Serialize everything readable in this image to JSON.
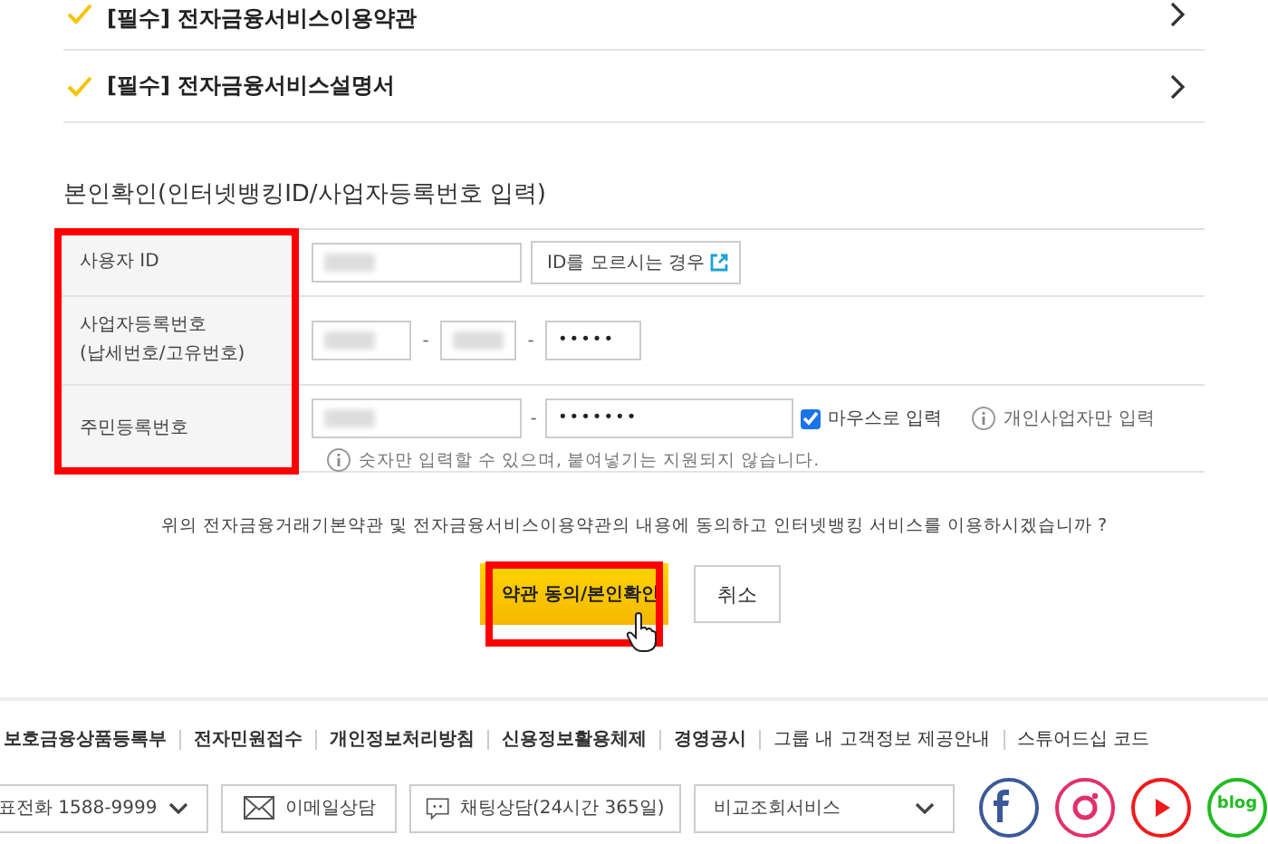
{
  "terms": [
    {
      "label": "[필수] 전자금융서비스이용약관",
      "checked": true
    },
    {
      "label": "[필수] 전자금융서비스설명서",
      "checked": true
    }
  ],
  "section_title": "본인확인(인터넷뱅킹ID/사업자등록번호 입력)",
  "form": {
    "rows": [
      {
        "kind": "id",
        "label": "사용자 ID",
        "button": "ID를 모르시는 경우"
      },
      {
        "kind": "business",
        "label": "사업자등록번호\n(납세번호/고유번호)",
        "separator": "-",
        "masked_value": "•••••"
      },
      {
        "kind": "resident",
        "label": "주민등록번호",
        "separator": "-",
        "masked_value": "•••••••",
        "mouse_input": {
          "label": "마우스로 입력",
          "checked": true
        },
        "note": "개인사업자만 입력",
        "hint": "숫자만 입력할 수 있으며, 붙여넣기는 지원되지 않습니다."
      }
    ],
    "highlighted": true
  },
  "question": "위의 전자금융거래기본약관 및 전자금융서비스이용약관의 내용에 동의하고 인터넷뱅킹 서비스를 이용하시겠습니까 ?",
  "buttons": [
    {
      "label": "약관 동의/본인확인",
      "kind": "primary",
      "highlighted": true
    },
    {
      "label": "취소",
      "kind": "secondary",
      "highlighted": false
    }
  ],
  "footer": {
    "links": [
      {
        "label": "보호금융상품등록부",
        "bold": true
      },
      {
        "label": "전자민원접수",
        "bold": true
      },
      {
        "label": "개인정보처리방침",
        "bold": true
      },
      {
        "label": "신용정보활용체제",
        "bold": true
      },
      {
        "label": "경영공시",
        "bold": true
      },
      {
        "label": "그룹 내 고객정보 제공안내",
        "bold": false
      },
      {
        "label": "스튜어드십 코드",
        "bold": false
      }
    ],
    "contacts": [
      {
        "kind": "phone",
        "label": "표전화 1588-9999"
      },
      {
        "kind": "email",
        "label": "이메일상담"
      },
      {
        "kind": "chat",
        "label": "채팅상담(24시간 365일)"
      },
      {
        "kind": "select",
        "label": "비교조회서비스"
      }
    ],
    "social": [
      {
        "kind": "facebook",
        "color": "#3b5998"
      },
      {
        "kind": "instagram",
        "color": "#e1306c"
      },
      {
        "kind": "youtube",
        "color": "#ee1c1c"
      },
      {
        "kind": "blog",
        "color": "#22bb22",
        "label": "blog"
      }
    ]
  }
}
